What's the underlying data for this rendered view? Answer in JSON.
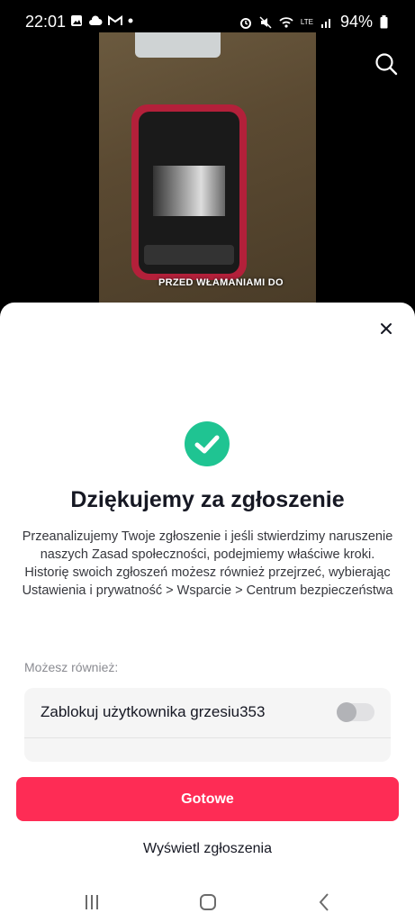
{
  "status_bar": {
    "time": "22:01",
    "battery": "94%",
    "network": "LTE"
  },
  "video": {
    "caption": "PRZED WŁAMANIAMI DO"
  },
  "sheet": {
    "title": "Dziękujemy za zgłoszenie",
    "description": "Przeanalizujemy Twoje zgłoszenie i jeśli stwierdzimy naruszenie naszych Zasad społeczności, podejmiemy właściwe kroki. Historię swoich zgłoszeń możesz również przejrzeć, wybierając Ustawienia i prywatność > Wsparcie > Centrum bezpieczeństwa",
    "options_heading": "Możesz również:",
    "block_option_label": "Zablokuj użytkownika grzesiu353",
    "block_toggle_on": false,
    "done_button": "Gotowe",
    "view_reports_link": "Wyświetl zgłoszenia"
  },
  "colors": {
    "accent": "#fe2c55",
    "success": "#1fc492"
  }
}
